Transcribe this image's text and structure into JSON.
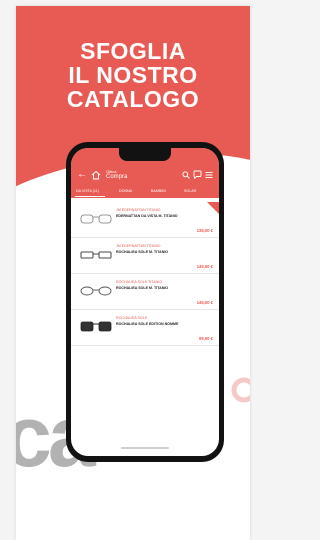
{
  "promo": {
    "headline_line1": "SFOGLIA",
    "headline_line2": "IL NOSTRO",
    "headline_line3": "CATALOGO",
    "background_letters": "ca"
  },
  "app": {
    "header": {
      "small_label": "Ottica",
      "title": "Compra"
    },
    "tabs": [
      {
        "label": "DA VISTA (11)"
      },
      {
        "label": "DONNA"
      },
      {
        "label": "BAMBINI"
      },
      {
        "label": "SOLAR"
      }
    ],
    "products": [
      {
        "brand": "JM EDERNATTAN TITANIO",
        "name": "EDERNATTAN DA VISTA M. TITANIO",
        "price": "139,00 €"
      },
      {
        "brand": "JM EDERNATTAN TITANIO",
        "name": "ROCHALIEA SOLE M. TITANIO",
        "price": "149,00 €"
      },
      {
        "brand": "ROCHALIEA SOLE TITANIO",
        "name": "ROCHALIEA SOLE M. TITANIO",
        "price": "149,00 €"
      },
      {
        "brand": "ROCHALIEA SOLE",
        "name": "ROCHALIEA SOLE EDITION NOMME",
        "price": "99,00 €"
      }
    ]
  },
  "colors": {
    "brand": "#e85b54",
    "phone_frame": "#121212"
  }
}
